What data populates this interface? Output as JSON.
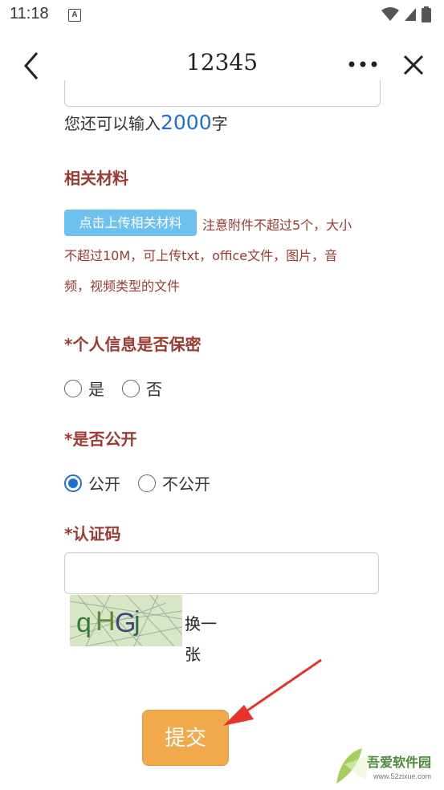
{
  "status": {
    "time": "11:18",
    "notif": "A"
  },
  "nav": {
    "title": "12345"
  },
  "form": {
    "char_count_prefix": "您还可以输入",
    "char_count_num": "2000",
    "char_count_suffix": "字",
    "materials_title": "相关材料",
    "upload_label": "点击上传相关材料",
    "upload_note_line1": "注意附件不超过5个，大小",
    "upload_note_line2": "不超过10M，可上传txt，office文件，图片，音",
    "upload_note_line3": "频，视频类型的文件",
    "privacy_title": "*个人信息是否保密",
    "privacy_options": [
      "是",
      "否"
    ],
    "public_title": "*是否公开",
    "public_options": [
      "公开",
      "不公开"
    ],
    "public_selected": "公开",
    "captcha_title": "*认证码",
    "captcha_value": "",
    "captcha_refresh_1": "换一",
    "captcha_refresh_2": "张",
    "submit_label": "提交"
  },
  "watermark": {
    "text": "吾爱软件园",
    "url": "www.52zixue.com"
  },
  "colors": {
    "accent_blue": "#1e6fd0",
    "title_red": "#9b3a2f",
    "upload_blue": "#6ec1ee",
    "submit_orange": "#f0aa4b"
  }
}
